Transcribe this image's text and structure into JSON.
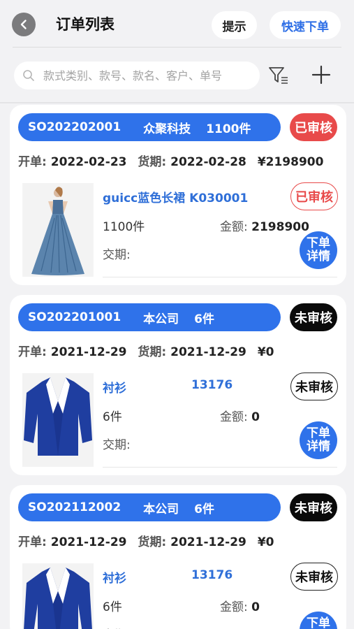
{
  "header": {
    "title": "订单列表",
    "hint_label": "提示",
    "quick_order_label": "快速下单"
  },
  "search": {
    "placeholder": "款式类别、款号、款名、客户、单号"
  },
  "labels": {
    "open_date": "开单:",
    "due_date": "货期:",
    "amount": "金额:",
    "delivery": "交期:",
    "detail_line1": "下单",
    "detail_line2": "详情"
  },
  "orders": [
    {
      "order_no": "SO202202001",
      "customer": "众聚科技",
      "quantity": "1100件",
      "status": "已审核",
      "open_date": "2022-02-23",
      "due_date": "2022-02-28",
      "total": "¥2198900",
      "item": {
        "image": "blue-ball-gown",
        "name": "guicc蓝色长裙 K030001",
        "code": "",
        "quantity": "1100件",
        "amount": "2198900",
        "status": "已审核",
        "delivery": ""
      }
    },
    {
      "order_no": "SO202201001",
      "customer": "本公司",
      "quantity": "6件",
      "status": "未审核",
      "open_date": "2021-12-29",
      "due_date": "2021-12-29",
      "total": "¥0",
      "item": {
        "image": "blue-blazer",
        "name": "衬衫",
        "code": "13176",
        "quantity": "6件",
        "amount": "0",
        "status": "未审核",
        "delivery": ""
      }
    },
    {
      "order_no": "SO202112002",
      "customer": "本公司",
      "quantity": "6件",
      "status": "未审核",
      "open_date": "2021-12-29",
      "due_date": "2021-12-29",
      "total": "¥0",
      "item": {
        "image": "blue-blazer",
        "name": "衬衫",
        "code": "13176",
        "quantity": "6件",
        "amount": "0",
        "status": "未审核",
        "delivery": ""
      }
    }
  ],
  "colors": {
    "primary": "#2f72ea",
    "approved": "#e84a4a",
    "pending": "#0a0a0a",
    "link": "#2f6fd8"
  }
}
